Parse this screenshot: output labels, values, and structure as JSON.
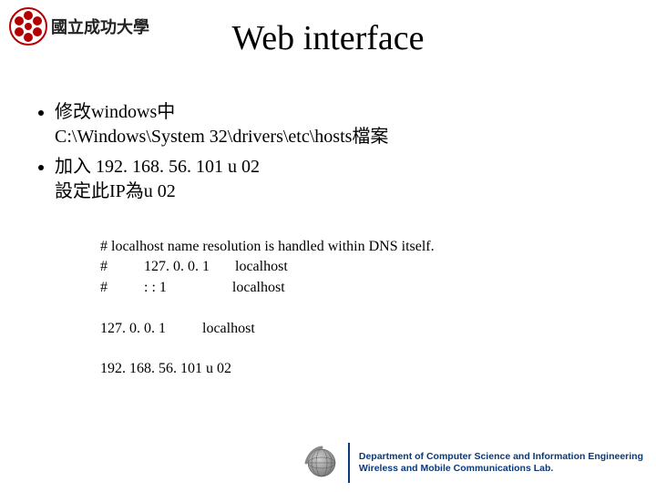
{
  "header": {
    "university_name": "國立成功大學"
  },
  "title": "Web interface",
  "bullets": [
    {
      "line1": "修改windows中",
      "line2": "C:\\Windows\\System 32\\drivers\\etc\\hosts檔案"
    },
    {
      "line1": "加入 192. 168. 56. 101 u 02",
      "line2": "設定此IP為u 02"
    }
  ],
  "code": {
    "l1": "# localhost name resolution is handled within DNS itself.",
    "l2": "#          127. 0. 0. 1       localhost",
    "l3": "#          : : 1                  localhost",
    "l4": "",
    "l5": "127. 0. 0. 1          localhost",
    "l6": "",
    "l7": "192. 168. 56. 101 u 02"
  },
  "footer": {
    "line1": "Department of Computer Science and Information Engineering",
    "line2": "Wireless and Mobile Communications Lab."
  }
}
